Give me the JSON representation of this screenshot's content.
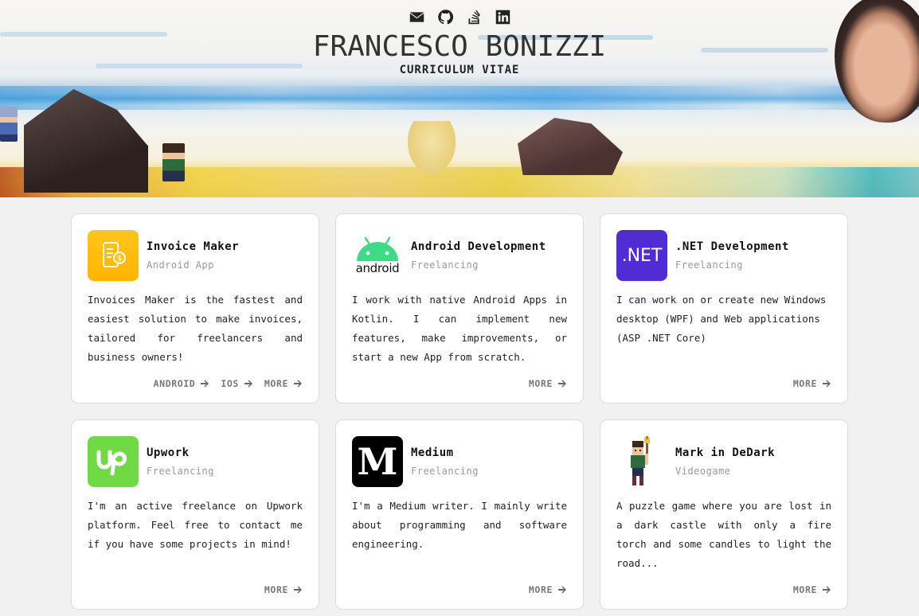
{
  "header": {
    "name": "FRANCESCO BONIZZI",
    "subtitle": "CURRICULUM VITAE",
    "social": [
      {
        "icon": "envelope-icon"
      },
      {
        "icon": "github-icon"
      },
      {
        "icon": "stackoverflow-icon"
      },
      {
        "icon": "linkedin-icon"
      }
    ]
  },
  "cards": [
    {
      "title": "Invoice Maker",
      "subtitle": "Android App",
      "logo": "invoice-maker-logo",
      "description": "Invoices Maker is the fastest and easiest solution to make invoices, tailored for freelancers and business owners!",
      "links": [
        "ANDROID",
        "IOS",
        "MORE"
      ]
    },
    {
      "title": "Android Development",
      "subtitle": "Freelancing",
      "logo": "android-logo",
      "logo_text": "android",
      "description": "I work with native Android Apps in Kotlin. I can implement new features, make improvements, or start a new App from scratch.",
      "links": [
        "MORE"
      ]
    },
    {
      "title": ".NET Development",
      "subtitle": "Freelancing",
      "logo": "dotnet-logo",
      "logo_text": ".NET",
      "description": "I can work on or create new Windows desktop (WPF) and Web applications (ASP .NET Core)",
      "links": [
        "MORE"
      ]
    },
    {
      "title": "Upwork",
      "subtitle": "Freelancing",
      "logo": "upwork-logo",
      "description": "I'm an active freelance on Upwork platform. Feel free to contact me if you have some projects in mind!",
      "links": [
        "MORE"
      ]
    },
    {
      "title": "Medium",
      "subtitle": "Freelancing",
      "logo": "medium-logo",
      "logo_text": "M",
      "description": "I'm a Medium writer. I mainly write about programming and software engineering.",
      "links": [
        "MORE"
      ]
    },
    {
      "title": "Mark in DeDark",
      "subtitle": "Videogame",
      "logo": "mark-in-dedark-logo",
      "description": "A puzzle game where you are lost in a dark castle with only a fire torch and some candles to light the road...",
      "links": [
        "MORE"
      ]
    }
  ],
  "colors": {
    "background": "#f1f1f1",
    "card_border": "#dcdcdc",
    "link": "#777777",
    "subtitle": "#999999",
    "dotnet": "#512bd4",
    "upwork": "#6fda44",
    "android": "#3ddc84",
    "invoice": "#ffb400"
  }
}
